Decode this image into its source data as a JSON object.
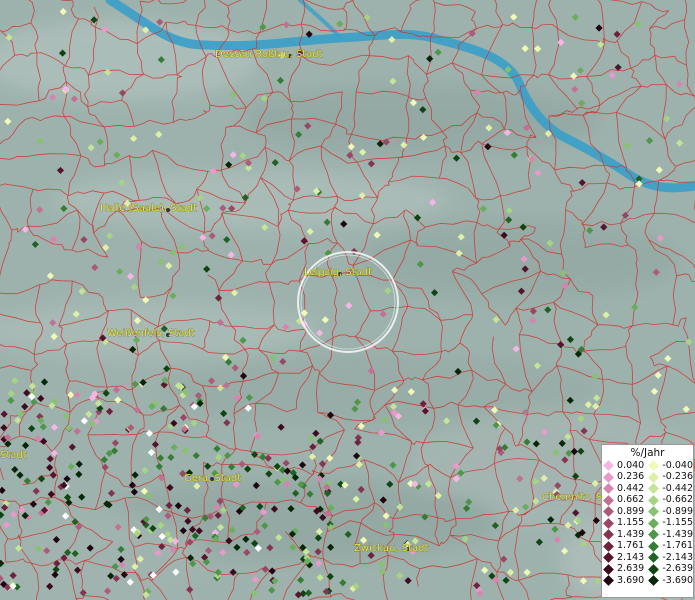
{
  "map": {
    "cities": [
      {
        "name": "Dessau-Roßlau, Stadt"
      },
      {
        "name": "Halle (Saale), Stadt"
      },
      {
        "name": "Leipzig, Stadt"
      },
      {
        "name": "Weißenfels, Stadt"
      },
      {
        "name": "Gera, Stadt"
      },
      {
        "name": "Zwickau, Stadt"
      },
      {
        "name": "Chemnitz, S"
      },
      {
        "name": "Stadt"
      }
    ],
    "colors": {
      "background": "#9fb3ae",
      "river": "#3aa0c8",
      "boundary": "#d0302c",
      "label": "#e8e84a"
    }
  },
  "legend": {
    "title": "%/Jahr",
    "positive": [
      {
        "value": "0.040",
        "color": "#f5b6e6"
      },
      {
        "value": "0.236",
        "color": "#e79acb"
      },
      {
        "value": "0.442",
        "color": "#d585b0"
      },
      {
        "value": "0.662",
        "color": "#c27094"
      },
      {
        "value": "0.899",
        "color": "#ad5a7b"
      },
      {
        "value": "1.155",
        "color": "#994766"
      },
      {
        "value": "1.439",
        "color": "#843552"
      },
      {
        "value": "1.761",
        "color": "#6d2340"
      },
      {
        "value": "2.143",
        "color": "#56142e"
      },
      {
        "value": "2.639",
        "color": "#3d0a1f"
      },
      {
        "value": "3.690",
        "color": "#200310"
      }
    ],
    "negative": [
      {
        "value": "-0.040",
        "color": "#f2f9b6"
      },
      {
        "value": "-0.236",
        "color": "#ddf0a6"
      },
      {
        "value": "-0.442",
        "color": "#c4e496"
      },
      {
        "value": "-0.662",
        "color": "#a6d484"
      },
      {
        "value": "-0.899",
        "color": "#88c170"
      },
      {
        "value": "-1.155",
        "color": "#6aad5c"
      },
      {
        "value": "-1.439",
        "color": "#4e9749"
      },
      {
        "value": "-1.761",
        "color": "#357d35"
      },
      {
        "value": "-2.143",
        "color": "#206222"
      },
      {
        "value": "-2.639",
        "color": "#0f4512"
      },
      {
        "value": "-3.690",
        "color": "#042807"
      }
    ]
  }
}
